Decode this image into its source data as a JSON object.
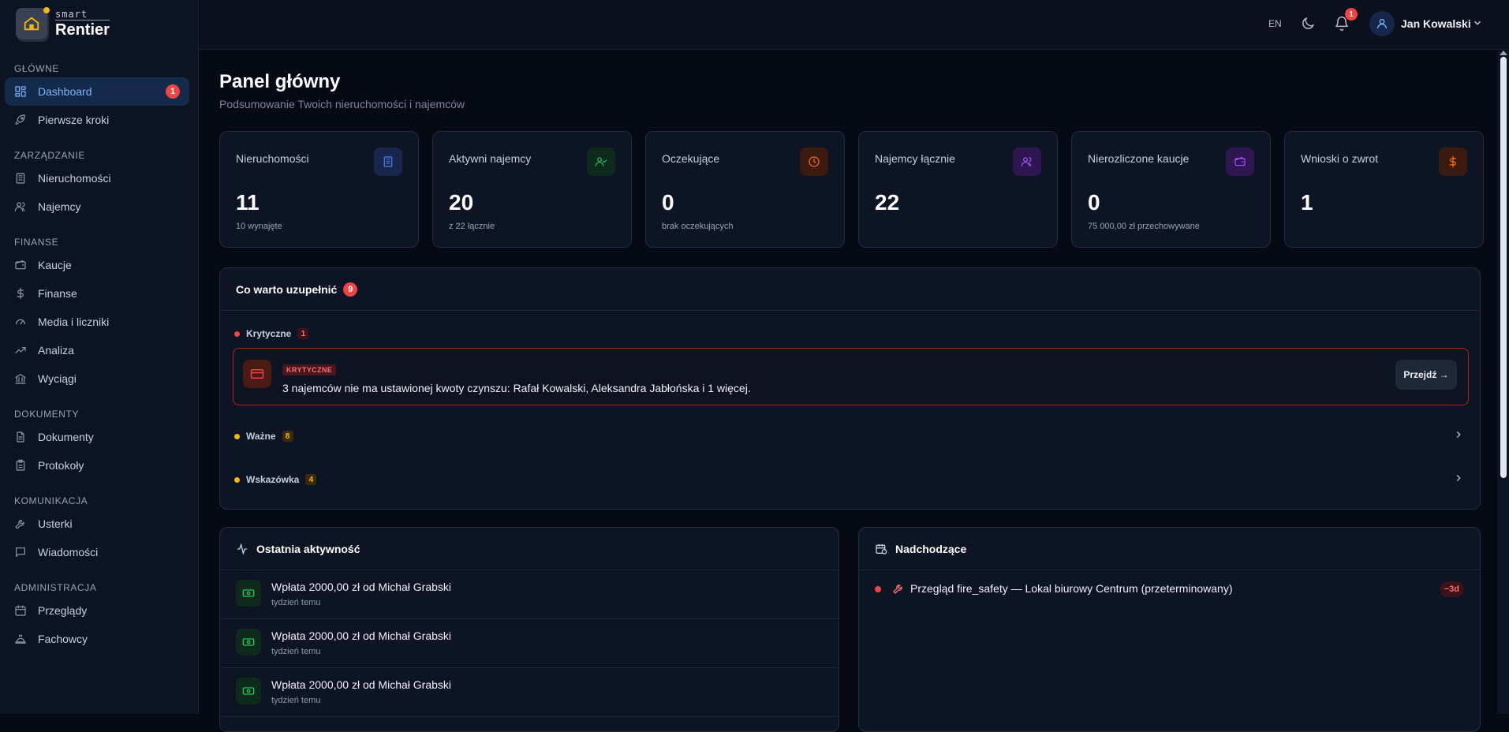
{
  "brand": {
    "small": "smart",
    "big": "Rentier"
  },
  "topbar": {
    "lang": "EN",
    "notifications_count": "1",
    "user_name": "Jan Kowalski"
  },
  "sidebar": {
    "sections": [
      {
        "title": "GŁÓWNE",
        "items": [
          {
            "label": "Dashboard",
            "icon": "dashboard-icon",
            "badge": "1",
            "active": true
          },
          {
            "label": "Pierwsze kroki",
            "icon": "rocket-icon"
          }
        ]
      },
      {
        "title": "ZARZĄDZANIE",
        "items": [
          {
            "label": "Nieruchomości",
            "icon": "building-icon"
          },
          {
            "label": "Najemcy",
            "icon": "users-icon"
          }
        ]
      },
      {
        "title": "FINANSE",
        "items": [
          {
            "label": "Kaucje",
            "icon": "wallet-icon"
          },
          {
            "label": "Finanse",
            "icon": "dollar-icon"
          },
          {
            "label": "Media i liczniki",
            "icon": "gauge-icon"
          },
          {
            "label": "Analiza",
            "icon": "trend-icon"
          },
          {
            "label": "Wyciągi",
            "icon": "bank-icon"
          }
        ]
      },
      {
        "title": "DOKUMENTY",
        "items": [
          {
            "label": "Dokumenty",
            "icon": "document-icon"
          },
          {
            "label": "Protokoły",
            "icon": "clipboard-icon"
          }
        ]
      },
      {
        "title": "KOMUNIKACJA",
        "items": [
          {
            "label": "Usterki",
            "icon": "wrench-icon"
          },
          {
            "label": "Wiadomości",
            "icon": "message-icon"
          }
        ]
      },
      {
        "title": "ADMINISTRACJA",
        "items": [
          {
            "label": "Przeglądy",
            "icon": "calendar-icon"
          },
          {
            "label": "Fachowcy",
            "icon": "hardhat-icon"
          }
        ]
      }
    ]
  },
  "page": {
    "title": "Panel główny",
    "subtitle": "Podsumowanie Twoich nieruchomości i najemców"
  },
  "stats": [
    {
      "label": "Nieruchomości",
      "value": "11",
      "sub": "10 wynajęte",
      "icon": "building-icon",
      "color": "#4f7cf0",
      "bg": "#17264a"
    },
    {
      "label": "Aktywni najemcy",
      "value": "20",
      "sub": "z 22 łącznie",
      "icon": "user-check-icon",
      "color": "#22c55e",
      "bg": "#0e2a1c"
    },
    {
      "label": "Oczekujące",
      "value": "0",
      "sub": "brak oczekujących",
      "icon": "clock-icon",
      "color": "#f97316",
      "bg": "#3b1a10"
    },
    {
      "label": "Najemcy łącznie",
      "value": "22",
      "sub": "",
      "icon": "users-icon",
      "color": "#a855f7",
      "bg": "#2e1750"
    },
    {
      "label": "Nierozliczone kaucje",
      "value": "0",
      "sub": "75 000,00 zł przechowywane",
      "icon": "wallet-icon",
      "color": "#a855f7",
      "bg": "#2e1750"
    },
    {
      "label": "Wnioski o zwrot",
      "value": "1",
      "sub": "",
      "icon": "dollar-icon",
      "color": "#f97316",
      "bg": "#3b1a10"
    }
  ],
  "todo": {
    "title": "Co warto uzupełnić",
    "count": "9",
    "groups": [
      {
        "label": "Krytyczne",
        "count": "1",
        "color": "#ef4444"
      },
      {
        "label": "Ważne",
        "count": "8",
        "color": "#f5b800"
      },
      {
        "label": "Wskazówka",
        "count": "4",
        "color": "#f5b800"
      }
    ],
    "critical_item": {
      "tag": "KRYTYCZNE",
      "text": "3 najemców nie ma ustawionej kwoty czynszu: Rafał Kowalski, Aleksandra Jabłońska i 1 więcej.",
      "button": "Przejdź →"
    }
  },
  "activity": {
    "title": "Ostatnia aktywność",
    "items": [
      {
        "title": "Wpłata 2000,00 zł od Michał Grabski",
        "time": "tydzień temu"
      },
      {
        "title": "Wpłata 2000,00 zł od Michał Grabski",
        "time": "tydzień temu"
      },
      {
        "title": "Wpłata 2000,00 zł od Michał Grabski",
        "time": "tydzień temu"
      }
    ]
  },
  "upcoming": {
    "title": "Nadchodzące",
    "items": [
      {
        "text": "Przegląd fire_safety — Lokal biurowy Centrum (przeterminowany)",
        "badge": "−3d"
      }
    ]
  }
}
